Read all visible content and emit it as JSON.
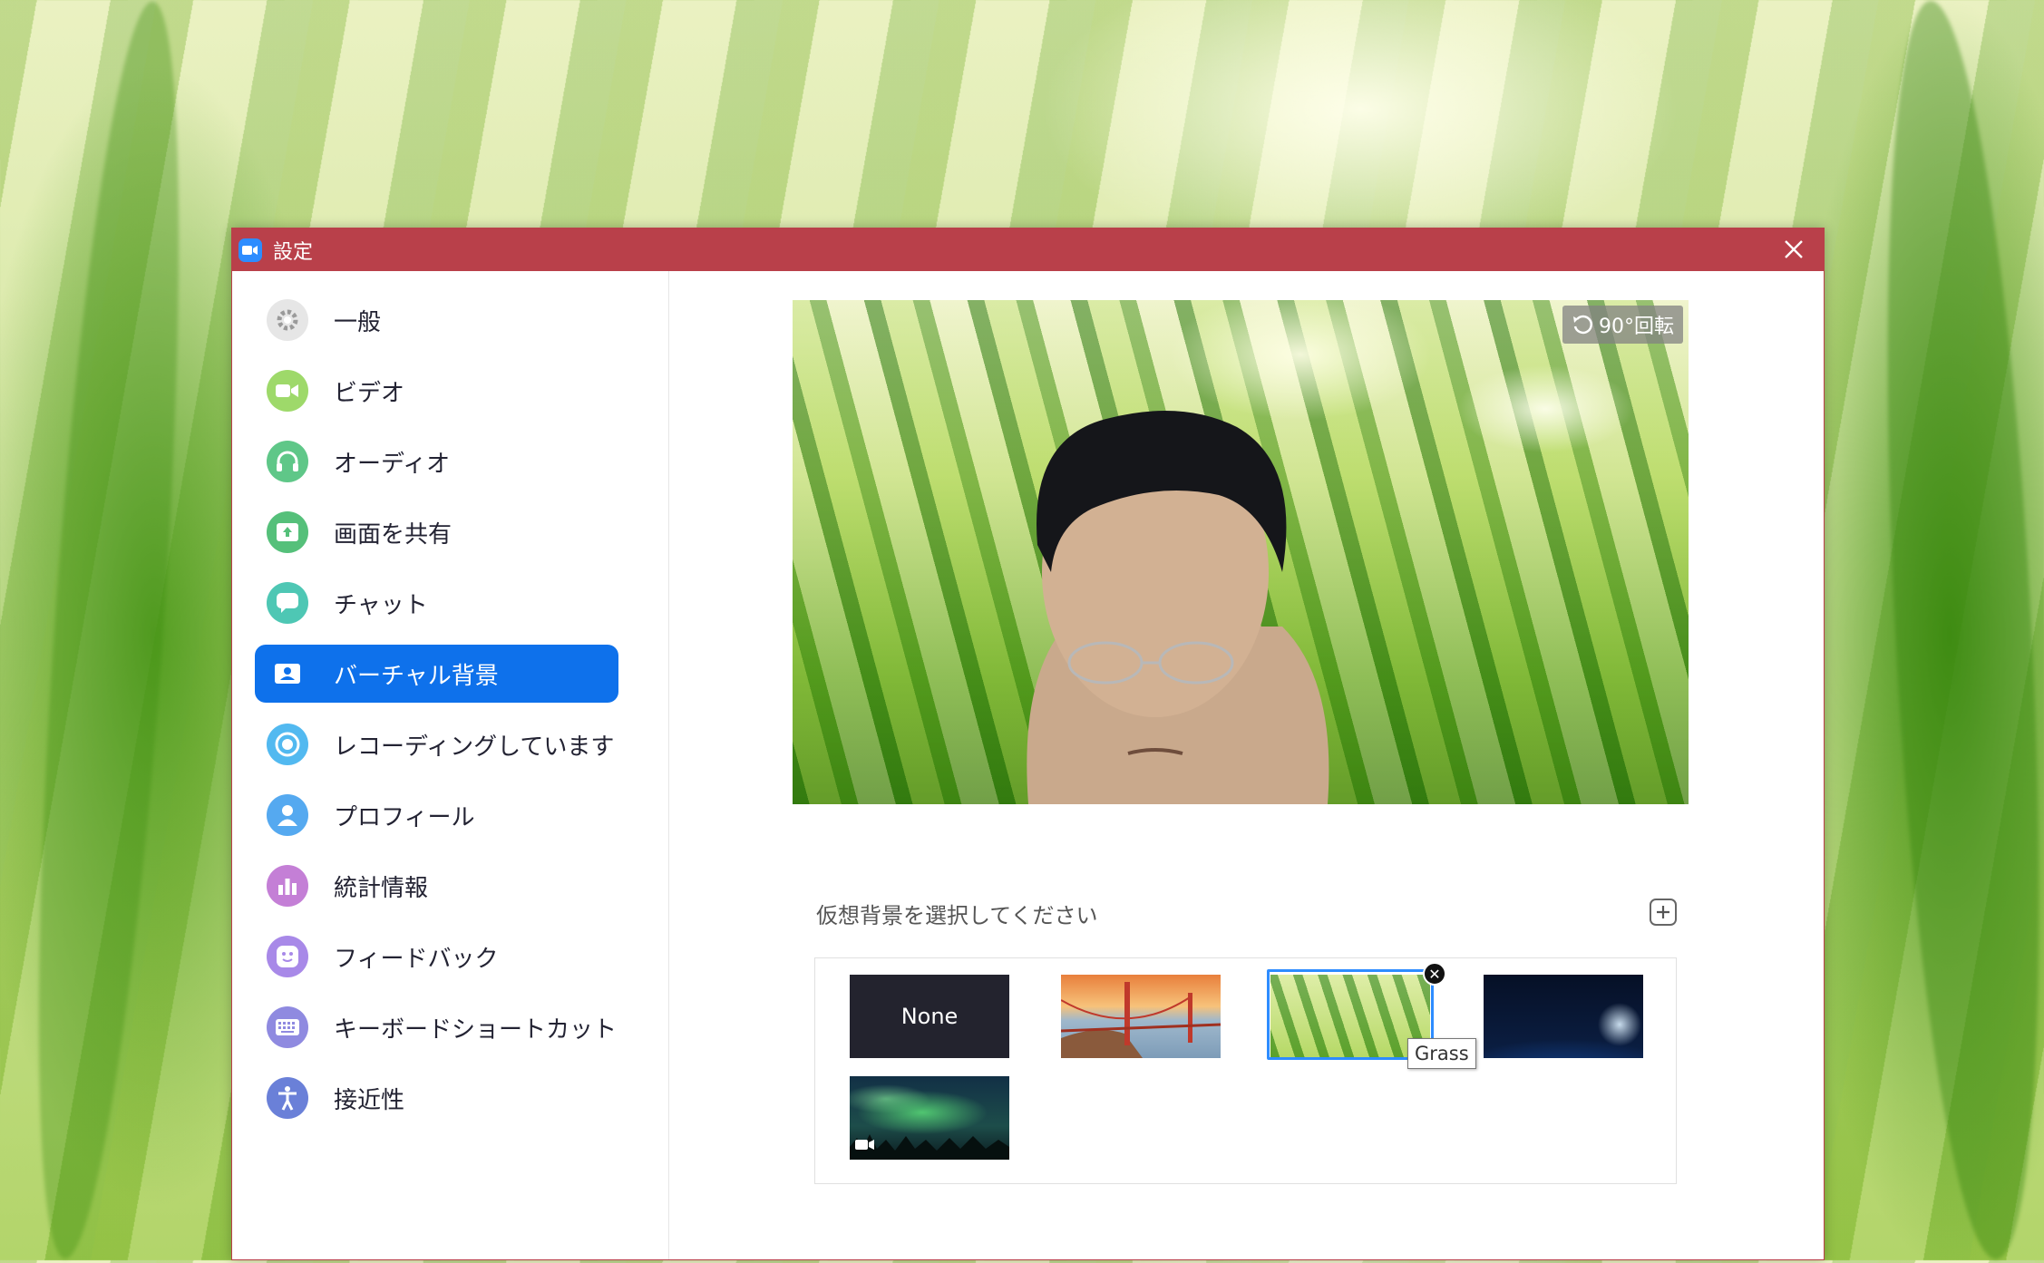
{
  "window": {
    "title": "設定",
    "close_icon": "close-icon"
  },
  "sidebar": {
    "items": [
      {
        "label": "一般",
        "icon": "gear-icon",
        "color": "#e8e8e8"
      },
      {
        "label": "ビデオ",
        "icon": "video-camera-icon",
        "color": "#9ed96a"
      },
      {
        "label": "オーディオ",
        "icon": "headphones-icon",
        "color": "#5fc788"
      },
      {
        "label": "画面を共有",
        "icon": "share-screen-icon",
        "color": "#55c07a"
      },
      {
        "label": "チャット",
        "icon": "chat-bubble-icon",
        "color": "#4ec7b4"
      },
      {
        "label": "バーチャル背景",
        "icon": "user-card-icon",
        "color": "#0e71eb",
        "active": true
      },
      {
        "label": "レコーディングしています",
        "icon": "record-icon",
        "color": "#52b9f0"
      },
      {
        "label": "プロフィール",
        "icon": "person-icon",
        "color": "#55a9f0"
      },
      {
        "label": "統計情報",
        "icon": "bar-chart-icon",
        "color": "#c47fd6"
      },
      {
        "label": "フィードバック",
        "icon": "smile-icon",
        "color": "#a889e8"
      },
      {
        "label": "キーボードショートカット",
        "icon": "keyboard-icon",
        "color": "#8f8ae0"
      },
      {
        "label": "接近性",
        "icon": "accessibility-icon",
        "color": "#6a80d8"
      }
    ]
  },
  "preview": {
    "rotate_label": "90°回転",
    "rotate_icon": "rotate-icon"
  },
  "background_picker": {
    "label": "仮想背景を選択してください",
    "add_icon": "add-icon",
    "thumbnails": [
      {
        "name": "None",
        "label": "None"
      },
      {
        "name": "golden-gate-bridge"
      },
      {
        "name": "Grass",
        "selected": true
      },
      {
        "name": "earth-from-space"
      },
      {
        "name": "aurora-video"
      }
    ],
    "tooltip": "Grass",
    "accent": "#2d8cff"
  }
}
